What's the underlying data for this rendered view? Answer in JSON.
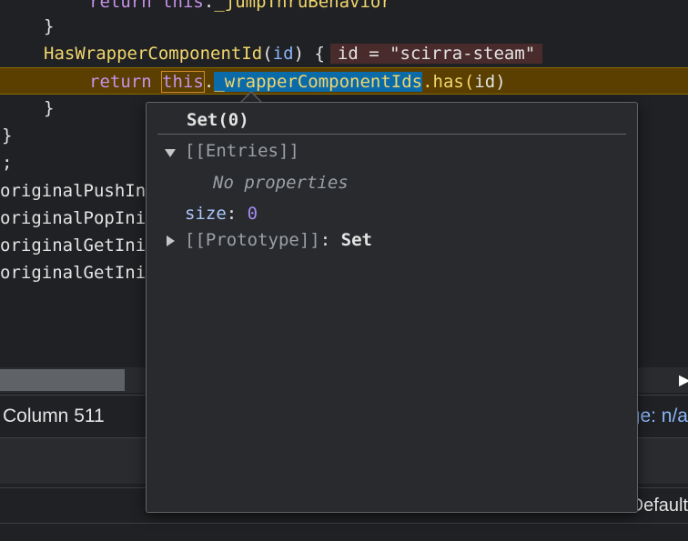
{
  "code": {
    "line0": {
      "keyword": "return",
      "this": "this",
      "dot": ".",
      "prop": "_jumpThruBehavior"
    },
    "line1": {
      "brace": "}"
    },
    "line2": {
      "fn": "HasWrapperComponentId",
      "open": "(",
      "param": "id",
      "close": ")",
      "brace": " {",
      "inline_value": "id = \"scirra-steam\""
    },
    "line3": {
      "keyword": "return",
      "this": "this",
      "dot": ".",
      "prop": "_wrapperComponentIds",
      "method": ".has(",
      "param": "id",
      "close": ")"
    },
    "line4": {
      "brace": "}"
    },
    "line5": {
      "brace": "}"
    },
    "line6": {
      "text": ";"
    },
    "line7": {
      "text": "originalPushIn"
    },
    "line8": {
      "text": "originalPopIni"
    },
    "line9": {
      "text": "originalGetIni"
    },
    "line10": {
      "text": "originalGetIni"
    }
  },
  "popover": {
    "title": "Set(0)",
    "entries_label": "[[Entries]]",
    "no_properties": "No properties",
    "size_key": "size",
    "size_colon": ":",
    "size_value": "0",
    "prototype_label": "[[Prototype]]",
    "prototype_colon": ":",
    "prototype_value": "Set"
  },
  "status": {
    "cursor": "Column 511",
    "coverage": "ge: n/a"
  },
  "console": {
    "default_levels": "Default"
  }
}
